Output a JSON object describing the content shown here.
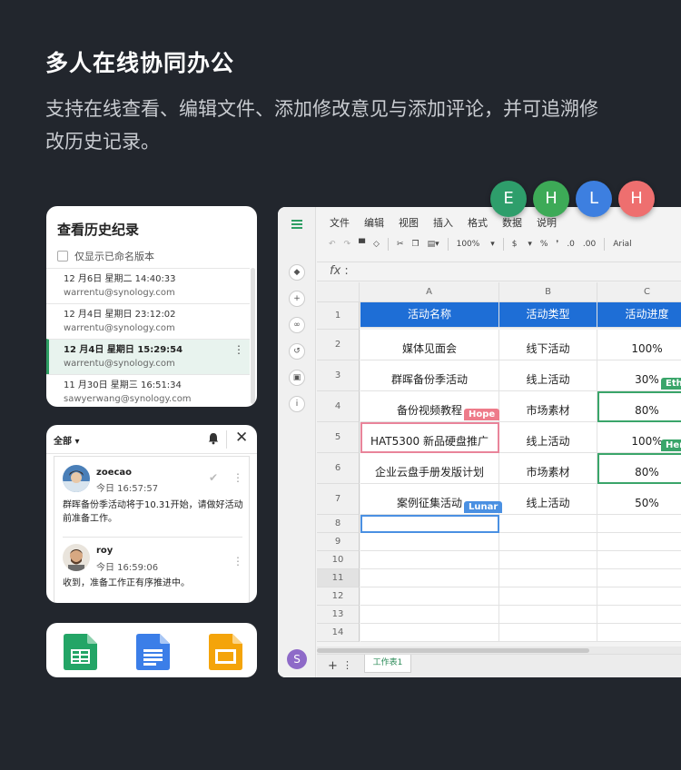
{
  "hero": {
    "title": "多人在线协同办公",
    "subtitle": "支持在线查看、编辑文件、添加修改意见与添加评论，并可追溯修改历史记录。"
  },
  "history": {
    "title": "查看历史纪录",
    "filter_label": "仅显示已命名版本",
    "items": [
      {
        "time": "12 月6日 星期二 14:40:33",
        "user": "warrentu@synology.com",
        "selected": false
      },
      {
        "time": "12 月4日 星期日 23:12:02",
        "user": "warrentu@synology.com",
        "selected": false
      },
      {
        "time": "12 月4日 星期日 15:29:54",
        "user": "warrentu@synology.com",
        "selected": true
      },
      {
        "time": "11 月30日 星期三 16:51:34",
        "user": "sawyerwang@synology.com",
        "selected": false
      }
    ]
  },
  "comments": {
    "filter": "全部",
    "entries": [
      {
        "name": "zoecao",
        "time": "今日 16:57:57",
        "text": "群晖备份季活动将于10.31开始，请做好活动前准备工作。"
      },
      {
        "name": "roy",
        "time": "今日 16:59:06",
        "text": "收到，准备工作正有序推进中。"
      }
    ]
  },
  "apps": [
    "sheets-icon",
    "docs-icon",
    "slides-icon"
  ],
  "sheet": {
    "menu": [
      "文件",
      "编辑",
      "视图",
      "插入",
      "格式",
      "数据",
      "说明"
    ],
    "toolbar": {
      "zoom": "100%",
      "currency": "$",
      "percent": "%",
      "dec_less": ".0",
      "dec_more": ".00",
      "font": "Arial"
    },
    "fx_label": "fx",
    "columns": [
      "A",
      "B",
      "C"
    ],
    "rows": [
      "1",
      "2",
      "3",
      "4",
      "5",
      "6",
      "7",
      "8",
      "9",
      "10",
      "11",
      "12",
      "13",
      "14"
    ],
    "header": [
      "活动名称",
      "活动类型",
      "活动进度"
    ],
    "data": [
      [
        "媒体见面会",
        "线下活动",
        "100%"
      ],
      [
        "群晖备份季活动",
        "线上活动",
        "30%"
      ],
      [
        "备份视频教程",
        "市场素材",
        "80%"
      ],
      [
        "HAT5300 新品硬盘推广",
        "线上活动",
        "100%"
      ],
      [
        "企业云盘手册发版计划",
        "市场素材",
        "80%"
      ],
      [
        "案例征集活动",
        "线上活动",
        "50%"
      ]
    ],
    "tags": {
      "hope": "Hope",
      "lunar": "Lunar",
      "eth": "Eth",
      "hen": "Hen"
    },
    "tab_name": "工作表1",
    "user_initial": "S"
  },
  "collaborators": [
    {
      "initial": "E",
      "color": "#2e9e6b"
    },
    {
      "initial": "H",
      "color": "#3daa57"
    },
    {
      "initial": "L",
      "color": "#3d7fe0"
    },
    {
      "initial": "H",
      "color": "#ee6f6f"
    }
  ]
}
